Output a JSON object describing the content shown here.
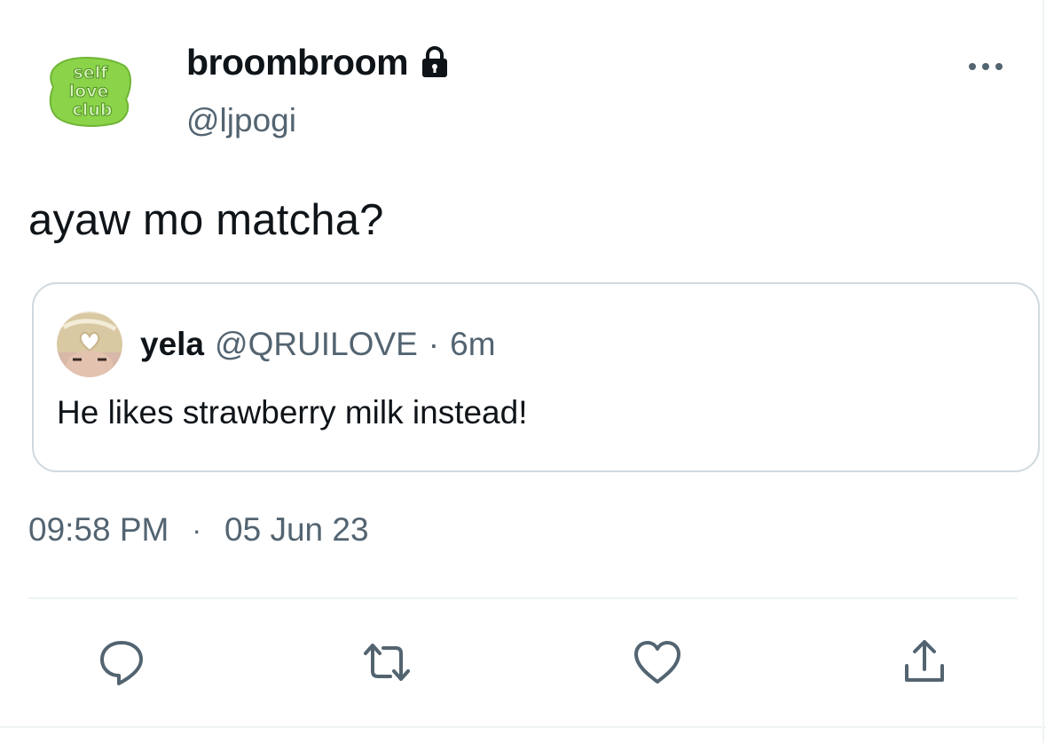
{
  "author": {
    "display_name": "broombroom",
    "handle": "@ljpogi",
    "locked": true,
    "avatar_text": [
      "self",
      "love",
      "club"
    ],
    "avatar_color": "#8bd44a"
  },
  "tweet": {
    "text": "ayaw mo matcha?",
    "time": "09:58 PM",
    "separator": "·",
    "date": "05 Jun 23"
  },
  "quote": {
    "name": "yela",
    "handle": "@QRUILOVE",
    "separator": "·",
    "time": "6m",
    "text": "He likes strawberry milk instead!"
  },
  "actions": [
    {
      "icon": "reply-icon"
    },
    {
      "icon": "retweet-icon"
    },
    {
      "icon": "like-icon"
    },
    {
      "icon": "share-icon"
    }
  ],
  "colors": {
    "text_primary": "#0f1419",
    "text_secondary": "#536471",
    "border": "#cfd9de",
    "divider": "#eff3f4"
  }
}
